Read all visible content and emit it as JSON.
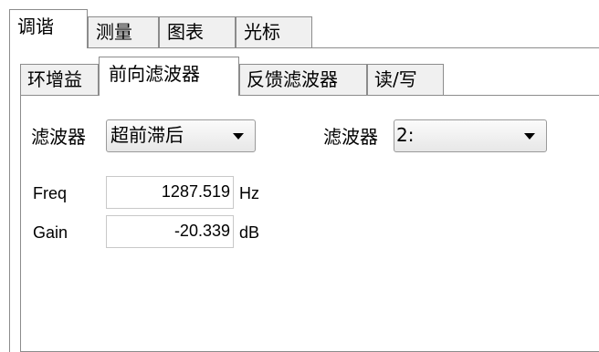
{
  "top_tabs": [
    {
      "label": "调谐",
      "active": true
    },
    {
      "label": "测量",
      "active": false
    },
    {
      "label": "图表",
      "active": false
    },
    {
      "label": "光标",
      "active": false
    }
  ],
  "sub_tabs": [
    {
      "label": "环增益",
      "active": false
    },
    {
      "label": "前向滤波器",
      "active": true
    },
    {
      "label": "反馈滤波器",
      "active": false
    },
    {
      "label": "读/写",
      "active": false
    }
  ],
  "filter_type": {
    "label": "滤波器",
    "value": "超前滞后"
  },
  "filter_index": {
    "label": "滤波器",
    "value": "2:"
  },
  "freq": {
    "label": "Freq",
    "value": "1287.519",
    "unit": "Hz"
  },
  "gain": {
    "label": "Gain",
    "value": "-20.339",
    "unit": "dB"
  }
}
